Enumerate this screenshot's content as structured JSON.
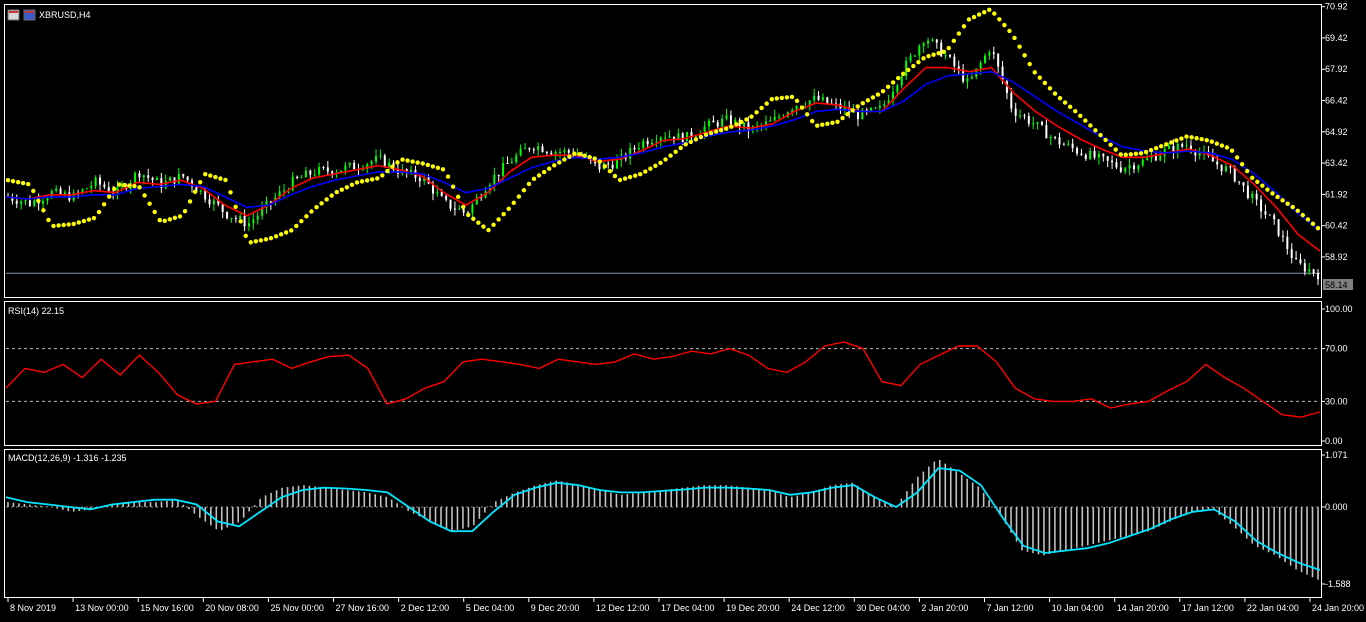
{
  "window": {
    "symbol_title": "XBRUSD,H4",
    "icon": "chart-window-icon"
  },
  "colors": {
    "background": "#000000",
    "bull_candle": "#00ff00",
    "bear_candle": "#ffffff",
    "ma_fast": "#ff0000",
    "ma_slow": "#0000ff",
    "sar": "#ffff00",
    "rsi": "#ff0000",
    "macd_hist": "#c0c0c0",
    "macd_signal": "#00e5ff",
    "grid_frame": "#ffffff",
    "price_tag_bg": "#808080"
  },
  "chart_data": [
    {
      "type": "candlestick",
      "title": "XBRUSD,H4",
      "ylim": [
        57.0,
        71.0
      ],
      "y_ticks": [
        "70.92",
        "69.42",
        "67.92",
        "66.42",
        "64.92",
        "63.42",
        "61.92",
        "60.42",
        "58.92"
      ],
      "current_price": "58.14",
      "x_ticks": [
        "8 Nov 2019",
        "13 Nov 00:00",
        "15 Nov 16:00",
        "20 Nov 08:00",
        "25 Nov 00:00",
        "27 Nov 16:00",
        "2 Dec 12:00",
        "5 Dec 04:00",
        "9 Dec 20:00",
        "12 Dec 12:00",
        "17 Dec 04:00",
        "19 Dec 20:00",
        "24 Dec 12:00",
        "30 Dec 04:00",
        "2 Jan 20:00",
        "7 Jan 12:00",
        "10 Jan 04:00",
        "14 Jan 20:00",
        "17 Jan 12:00",
        "22 Jan 04:00",
        "24 Jan 20:00"
      ],
      "close_trace": [
        61.8,
        61.5,
        62.0,
        61.8,
        62.5,
        62.0,
        63.0,
        62.4,
        62.8,
        61.9,
        61.0,
        60.5,
        61.5,
        62.5,
        63.0,
        63.1,
        63.3,
        63.6,
        63.0,
        62.7,
        61.5,
        61.0,
        62.5,
        63.5,
        64.3,
        64.0,
        63.9,
        63.2,
        63.5,
        64.4,
        64.8,
        64.6,
        65.2,
        65.5,
        65.0,
        65.4,
        66.2,
        66.5,
        66.1,
        65.7,
        66.0,
        67.9,
        69.5,
        68.5,
        67.2,
        69.0,
        66.0,
        65.3,
        64.5,
        64.0,
        63.6,
        63.2,
        63.5,
        64.0,
        64.3,
        63.6,
        63.0,
        61.7,
        60.5,
        58.6,
        58.1
      ],
      "series": [
        {
          "name": "",
          "kind": "ma-fast",
          "values": [
            61.8,
            61.7,
            61.9,
            61.9,
            62.1,
            62.0,
            62.5,
            62.4,
            62.6,
            62.2,
            61.4,
            60.9,
            61.4,
            62.2,
            62.7,
            62.9,
            63.1,
            63.3,
            63.1,
            62.8,
            62.0,
            61.4,
            62.0,
            63.0,
            63.7,
            63.8,
            63.8,
            63.5,
            63.6,
            64.0,
            64.5,
            64.6,
            64.9,
            65.2,
            65.1,
            65.3,
            65.9,
            66.3,
            66.2,
            65.9,
            65.9,
            67.0,
            68.0,
            68.0,
            67.8,
            68.0,
            66.8,
            65.9,
            65.2,
            64.6,
            64.1,
            63.7,
            63.7,
            63.9,
            64.1,
            63.8,
            63.3,
            62.4,
            61.3,
            60.0,
            59.2
          ]
        },
        {
          "name": "",
          "kind": "ma-slow",
          "values": [
            61.8,
            61.7,
            61.8,
            61.8,
            61.9,
            61.9,
            62.2,
            62.3,
            62.4,
            62.3,
            61.8,
            61.3,
            61.4,
            61.9,
            62.3,
            62.6,
            62.8,
            63.0,
            63.0,
            62.9,
            62.5,
            62.0,
            62.2,
            62.7,
            63.2,
            63.5,
            63.7,
            63.6,
            63.7,
            63.9,
            64.2,
            64.4,
            64.7,
            64.9,
            65.0,
            65.2,
            65.5,
            65.9,
            66.0,
            65.9,
            65.9,
            66.4,
            67.2,
            67.6,
            67.7,
            67.8,
            67.3,
            66.6,
            65.9,
            65.3,
            64.7,
            64.2,
            64.0,
            63.9,
            64.0,
            63.9,
            63.6,
            62.9,
            62.0,
            61.0,
            60.2
          ]
        },
        {
          "name": "",
          "kind": "parabolic-sar",
          "values": [
            62.6,
            62.4,
            60.4,
            60.5,
            60.8,
            62.4,
            62.3,
            60.6,
            60.9,
            62.9,
            62.6,
            59.6,
            59.8,
            60.2,
            61.2,
            62.0,
            62.5,
            62.7,
            63.6,
            63.4,
            63.1,
            61.0,
            60.2,
            61.3,
            62.6,
            63.3,
            63.9,
            63.6,
            62.6,
            62.9,
            63.5,
            64.3,
            64.8,
            65.1,
            65.6,
            66.5,
            66.6,
            65.2,
            65.4,
            66.2,
            66.8,
            67.7,
            68.5,
            68.8,
            70.3,
            70.8,
            69.6,
            67.8,
            66.7,
            65.8,
            64.8,
            63.8,
            63.9,
            64.3,
            64.7,
            64.5,
            64.1,
            62.7,
            61.9,
            61.2,
            60.3
          ]
        }
      ]
    },
    {
      "type": "line",
      "title": "RSI(14) 22.15",
      "ylim": [
        0,
        100
      ],
      "y_ticks": [
        "100.00",
        "70.00",
        "30.00",
        "0.00"
      ],
      "levels": [
        70,
        30
      ],
      "series": [
        {
          "name": "",
          "values": [
            40,
            55,
            52,
            58,
            48,
            62,
            50,
            65,
            52,
            35,
            28,
            30,
            58,
            60,
            62,
            55,
            60,
            64,
            65,
            55,
            28,
            32,
            40,
            45,
            60,
            62,
            60,
            58,
            55,
            62,
            60,
            58,
            60,
            66,
            62,
            64,
            68,
            66,
            70,
            65,
            55,
            52,
            60,
            72,
            75,
            70,
            45,
            42,
            58,
            65,
            72,
            72,
            60,
            40,
            32,
            30,
            30,
            32,
            25,
            28,
            30,
            38,
            45,
            58,
            48,
            40,
            30,
            20,
            18,
            22
          ]
        }
      ]
    },
    {
      "type": "bar",
      "title": "MACD(12,26,9) -1.316 -1.235",
      "ylim": [
        -1.588,
        1.071
      ],
      "y_ticks": [
        "1.071",
        "0.000",
        "-1.588"
      ],
      "series": [
        {
          "name": "",
          "kind": "histogram",
          "values": [
            0.1,
            0.05,
            0.0,
            -0.1,
            -0.05,
            0.05,
            0.1,
            0.1,
            0.15,
            -0.2,
            -0.5,
            -0.3,
            0.2,
            0.4,
            0.45,
            0.4,
            0.35,
            0.3,
            0.2,
            -0.1,
            -0.3,
            -0.5,
            -0.4,
            0.1,
            0.3,
            0.45,
            0.55,
            0.45,
            0.35,
            0.25,
            0.3,
            0.35,
            0.4,
            0.45,
            0.45,
            0.4,
            0.35,
            0.2,
            0.3,
            0.45,
            0.5,
            0.2,
            0.0,
            0.6,
            1.0,
            0.7,
            0.4,
            -0.2,
            -0.9,
            -1.0,
            -0.9,
            -0.8,
            -0.7,
            -0.6,
            -0.5,
            -0.3,
            -0.1,
            -0.05,
            -0.4,
            -0.8,
            -1.0,
            -1.3,
            -1.5
          ]
        },
        {
          "name": "",
          "kind": "signal",
          "values": [
            0.2,
            0.1,
            0.05,
            0.0,
            -0.05,
            0.05,
            0.1,
            0.15,
            0.15,
            0.05,
            -0.3,
            -0.4,
            -0.1,
            0.2,
            0.35,
            0.4,
            0.38,
            0.35,
            0.3,
            0.0,
            -0.3,
            -0.5,
            -0.5,
            -0.1,
            0.25,
            0.4,
            0.5,
            0.45,
            0.35,
            0.3,
            0.3,
            0.33,
            0.36,
            0.4,
            0.4,
            0.38,
            0.35,
            0.25,
            0.3,
            0.4,
            0.45,
            0.2,
            0.0,
            0.3,
            0.8,
            0.75,
            0.45,
            -0.2,
            -0.8,
            -0.95,
            -0.9,
            -0.85,
            -0.75,
            -0.6,
            -0.45,
            -0.25,
            -0.1,
            -0.05,
            -0.3,
            -0.7,
            -0.95,
            -1.15,
            -1.3
          ]
        }
      ]
    }
  ]
}
